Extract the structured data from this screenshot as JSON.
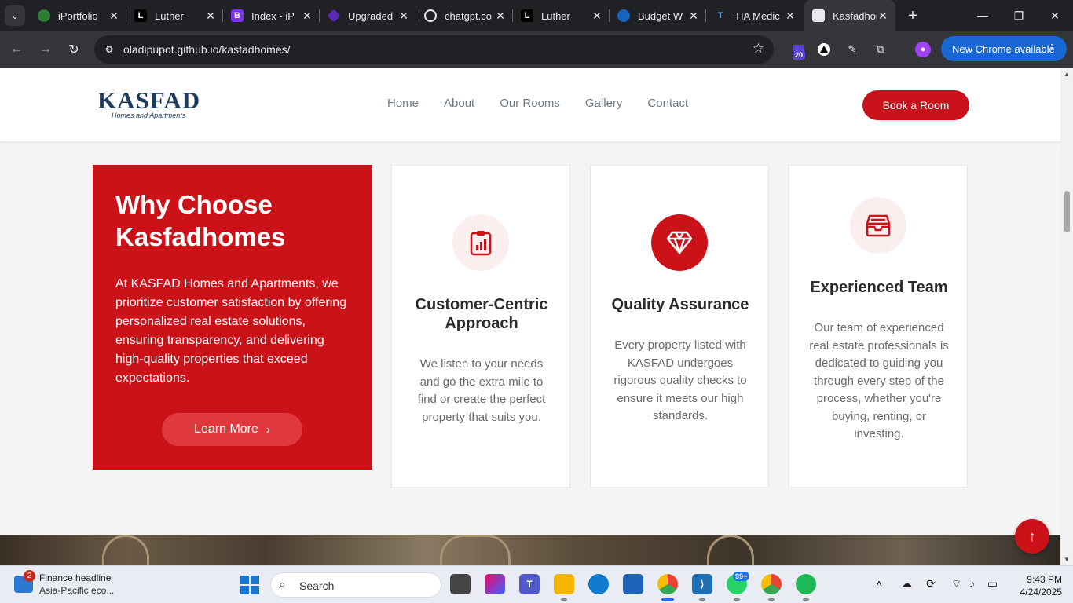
{
  "browser": {
    "tabs": [
      {
        "title": "iPortfolio",
        "favicon": "iportfolio-icon",
        "left": 0
      },
      {
        "title": "Luther",
        "favicon": "l-icon"
      },
      {
        "title": "Index - iP",
        "favicon": "bootstrap-icon"
      },
      {
        "title": "Upgraded",
        "favicon": "diamond-icon"
      },
      {
        "title": "chatgpt.co",
        "favicon": "openai-icon"
      },
      {
        "title": "Luther",
        "favicon": "l-icon"
      },
      {
        "title": "Budget W",
        "favicon": "shield-icon"
      },
      {
        "title": "TIA Medic",
        "favicon": "tia-icon"
      },
      {
        "title": "Kasfadhon",
        "favicon": "kasfad-icon",
        "active": true
      }
    ],
    "url": "oladipupot.github.io/kasfadhomes/",
    "extension_badge": "20",
    "update_button": "New Chrome available"
  },
  "site": {
    "logo": {
      "brand": "KASFAD",
      "tagline": "Homes and Apartments"
    },
    "nav": [
      "Home",
      "About",
      "Our Rooms",
      "Gallery",
      "Contact"
    ],
    "cta": "Book a Room"
  },
  "why": {
    "title": "Why Choose Kasfadhomes",
    "description": "At KASFAD Homes and Apartments, we prioritize customer satisfaction by offering personalized real estate solutions, ensuring transparency, and delivering high-quality properties that exceed expectations.",
    "button": "Learn More"
  },
  "features": [
    {
      "title": "Customer-Centric Approach",
      "body": "We listen to your needs and go the extra mile to find or create the perfect property that suits you.",
      "icon": "clipboard-chart-icon"
    },
    {
      "title": "Quality Assurance",
      "body": "Every property listed with KASFAD undergoes rigorous quality checks to ensure it meets our high standards.",
      "icon": "diamond-icon"
    },
    {
      "title": "Experienced Team",
      "body": "Our team of experienced real estate professionals is dedicated to guiding you through every step of the process, whether you're buying, renting, or investing.",
      "icon": "inbox-stack-icon"
    }
  ],
  "colors": {
    "brand_red": "#cc1219",
    "brand_navy": "#1f3b5e"
  },
  "taskbar": {
    "news_badge": "2",
    "news_title": "Finance headline",
    "news_sub": "Asia-Pacific eco...",
    "search_placeholder": "Search",
    "whatsapp_badge": "99+",
    "time": "9:43 PM",
    "date": "4/24/2025"
  }
}
